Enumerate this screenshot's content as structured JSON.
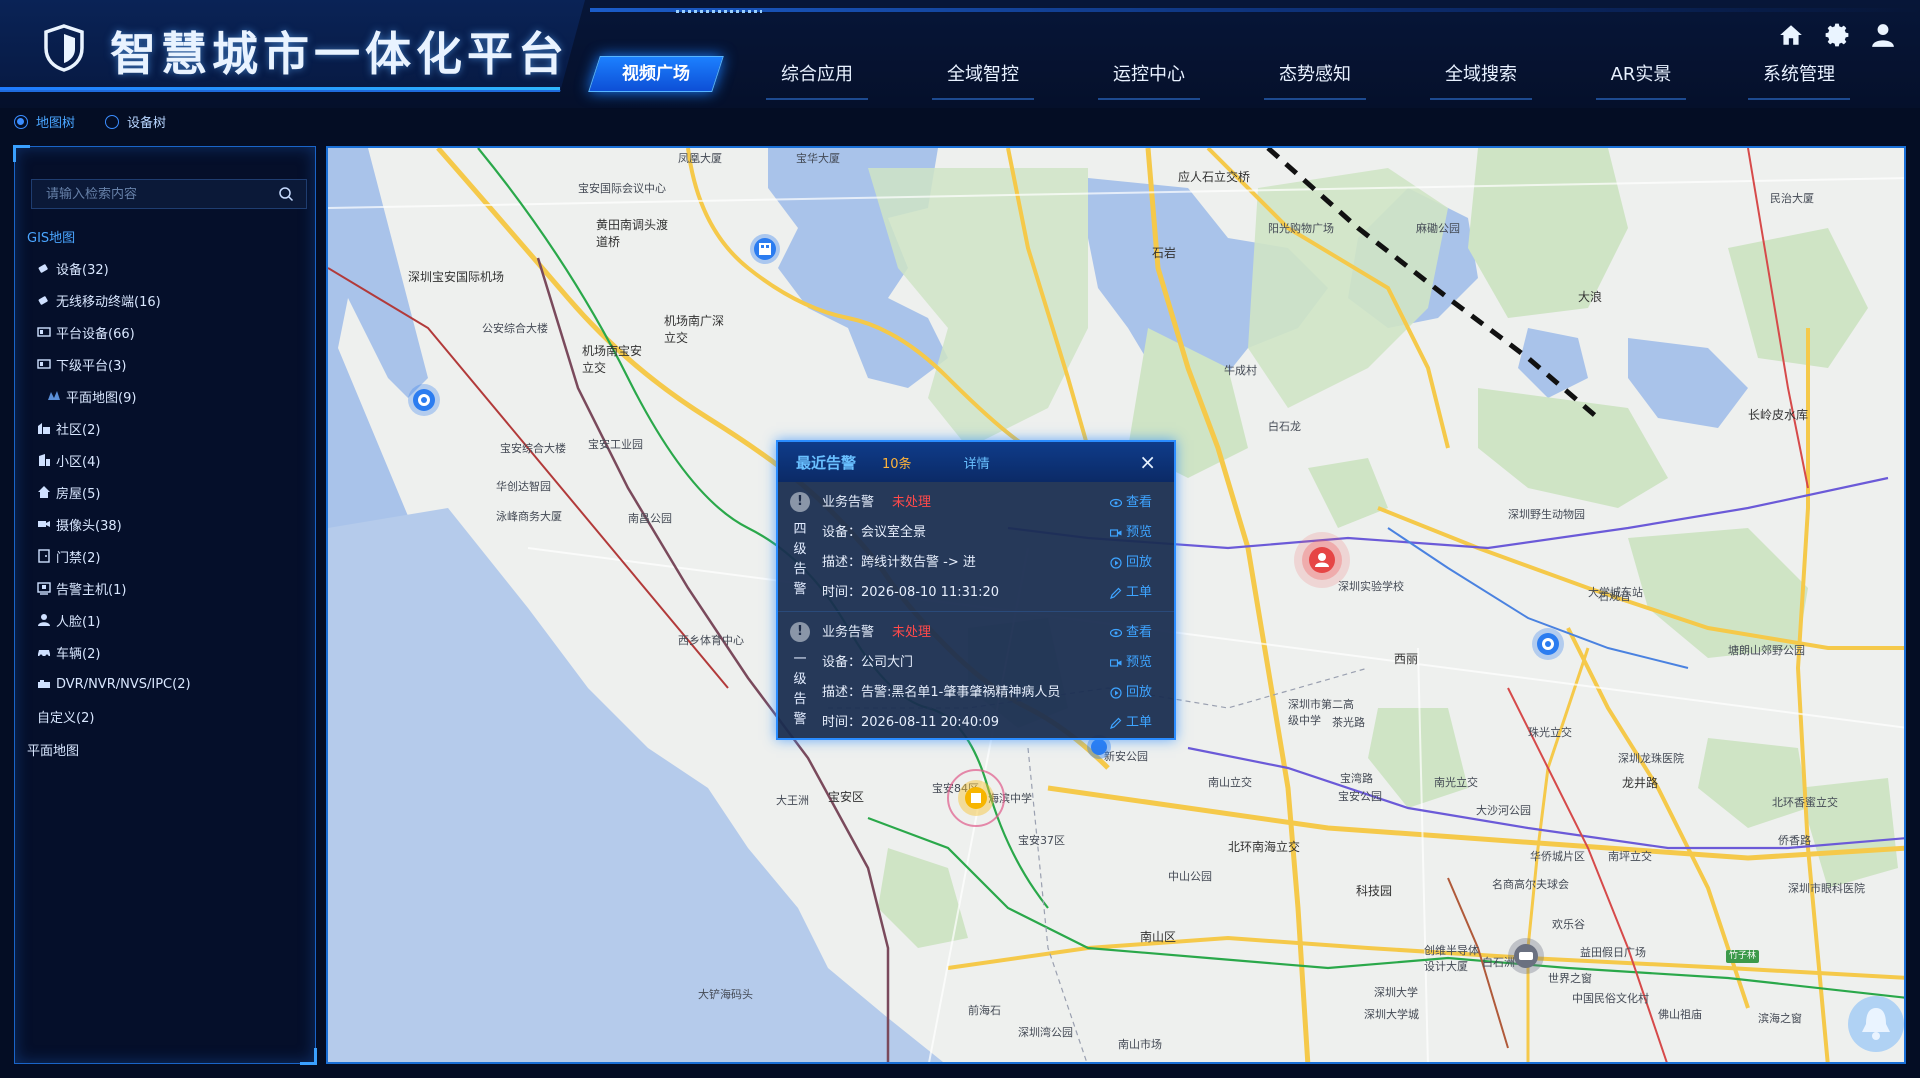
{
  "header": {
    "title": "智慧城市一体化平台",
    "active_nav": "视频广场",
    "nav": [
      "综合应用",
      "全域智控",
      "运控中心",
      "态势感知",
      "全域搜索",
      "AR实景",
      "系统管理"
    ],
    "icons": [
      "home-icon",
      "gear-icon",
      "user-icon"
    ]
  },
  "tree_switch": {
    "options": [
      "地图树",
      "设备树"
    ],
    "selected": "地图树"
  },
  "sidebar": {
    "search_placeholder": "请输入检索内容",
    "root": "GIS地图",
    "items": [
      {
        "label": "设备(32)",
        "icon": "device-icon"
      },
      {
        "label": "无线移动终端(16)",
        "icon": "mobile-terminal-icon"
      },
      {
        "label": "平台设备(66)",
        "icon": "platform-device-icon"
      },
      {
        "label": "下级平台(3)",
        "icon": "sub-platform-icon"
      },
      {
        "label": "平面地图(9)",
        "icon": "plane-map-icon"
      },
      {
        "label": "社区(2)",
        "icon": "community-icon"
      },
      {
        "label": "小区(4)",
        "icon": "residential-icon"
      },
      {
        "label": "房屋(5)",
        "icon": "house-icon"
      },
      {
        "label": "摄像头(38)",
        "icon": "camera-icon"
      },
      {
        "label": "门禁(2)",
        "icon": "door-access-icon"
      },
      {
        "label": "告警主机(1)",
        "icon": "alarm-host-icon"
      },
      {
        "label": "人脸(1)",
        "icon": "face-icon"
      },
      {
        "label": "车辆(2)",
        "icon": "vehicle-icon"
      },
      {
        "label": "DVR/NVR/NVS/IPC(2)",
        "icon": "recorder-icon"
      },
      {
        "label": "自定义(2)",
        "icon": ""
      }
    ],
    "root2": "平面地图"
  },
  "popup": {
    "title": "最近告警",
    "count": "10条",
    "detail": "详情",
    "close": "×",
    "alerts": [
      {
        "level": "四级告警",
        "type": "业务告警",
        "status": "未处理",
        "device": "设备：会议室全景",
        "desc": "描述：跨线计数告警 -> 进",
        "time": "时间：2026-08-10 11:31:20",
        "actions": [
          "查看",
          "预览",
          "回放",
          "工单"
        ]
      },
      {
        "level": "一级告警",
        "type": "业务告警",
        "status": "未处理",
        "device": "设备：公司大门",
        "desc": "描述：告警:黑名单1-肇事肇祸精神病人员",
        "time": "时间：2026-08-11 20:40:09",
        "actions": [
          "查看",
          "预览",
          "回放",
          "工单"
        ]
      }
    ]
  },
  "map": {
    "labels": [
      "凤凰大厦",
      "宝华大厦",
      "宝安国际会议中心",
      "深圳宝安国际机场",
      "公安综合大楼",
      "黄田南调头渡道桥",
      "机场南广深立交",
      "机场南宝安立交",
      "宝安综合大楼",
      "宝安工业园",
      "华创达智园",
      "泳峰商务大厦",
      "南昌公园",
      "西乡体育中心",
      "大王洲",
      "宝安区",
      "大铲海码头",
      "前海石",
      "中山公园",
      "南山区",
      "深圳湾公园",
      "南山市场",
      "滨海之窗",
      "民治大厦",
      "西丽",
      "深圳大学城",
      "科技园",
      "南山立交",
      "宝安公园",
      "北环南海立交",
      "宝安84区",
      "海滨中学",
      "宝安37区",
      "新安公园",
      "石观音",
      "应人石立交桥",
      "阳光购物广场",
      "麻磡公园",
      "大浪",
      "石岩",
      "牛成村",
      "白石龙",
      "深圳实验学校",
      "深圳野生动物园",
      "大学城东站",
      "长岭皮水库",
      "塘朗山郊野公园",
      "深圳龙珠医院",
      "北环香蜜立交",
      "侨香路",
      "深圳市眼科医院",
      "竹子林",
      "世界之窗",
      "中国民俗文化村",
      "佛山祖庙",
      "益田假日广场",
      "华侨城片区",
      "名商高尔夫球会",
      "欢乐谷",
      "白石洲",
      "创维半导体设计大厦",
      "深圳大学",
      "南坪立交",
      "龙井路",
      "南光立交",
      "宝湾路",
      "茶光路",
      "大沙河公园",
      "深圳市第二高级中学",
      "珠光立交"
    ]
  }
}
